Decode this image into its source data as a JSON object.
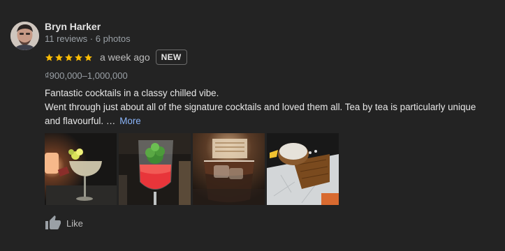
{
  "author": {
    "name": "Bryn Harker",
    "meta": "11 reviews · 6 photos"
  },
  "rating": {
    "stars": 5,
    "time": "a week ago",
    "badge": "NEW"
  },
  "price": "₫900,000–1,000,000",
  "review": {
    "line1": "Fantastic cocktails in a  classy chilled vibe.",
    "line2": "Went through just about all of the signature cocktails and loved them all. Tea by tea is particularly unique",
    "line3": "and flavourful. …",
    "more": "More"
  },
  "photos": [
    {
      "icon": "cocktail-photo-coupe"
    },
    {
      "icon": "cocktail-photo-red-garnish"
    },
    {
      "icon": "cocktail-photo-rocks-glass"
    },
    {
      "icon": "cocktail-photo-bowl-tray"
    }
  ],
  "actions": {
    "like_label": "Like"
  },
  "colors": {
    "background": "#232323",
    "star": "#fbbc04",
    "link": "#8ab4f8",
    "muted": "#9aa0a6"
  }
}
